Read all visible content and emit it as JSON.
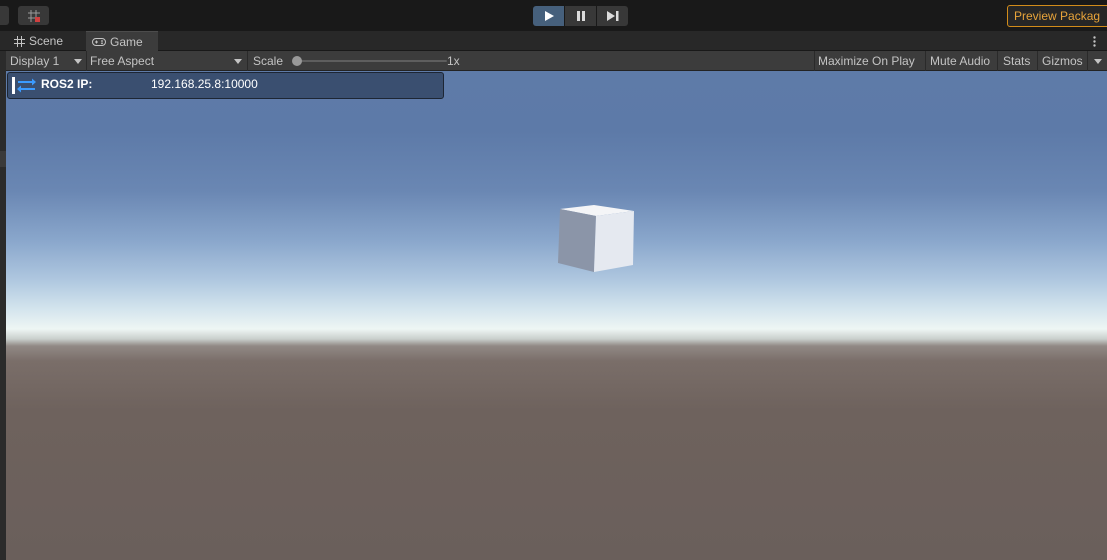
{
  "toolbar": {
    "preview_label": "Preview Packag",
    "play_icon": "play-icon",
    "pause_icon": "pause-icon",
    "step_icon": "step-icon",
    "grid_icon": "grid-snap-icon",
    "accent": "#46607c",
    "preview_color": "#d28c1a"
  },
  "tabs": [
    {
      "label": "Scene",
      "icon": "scene-grid-icon"
    },
    {
      "label": "Game",
      "icon": "gamepad-icon"
    }
  ],
  "gamebar": {
    "display": "Display 1",
    "aspect": "Free Aspect",
    "scale_label": "Scale",
    "scale_value": "1x",
    "scale_fraction": 0.0,
    "maximize": "Maximize On Play",
    "mute": "Mute Audio",
    "stats": "Stats",
    "gizmos": "Gizmos"
  },
  "ros": {
    "label": "ROS2 IP:",
    "value": "192.168.25.8:10000",
    "icon": "ros-connection-icon"
  }
}
